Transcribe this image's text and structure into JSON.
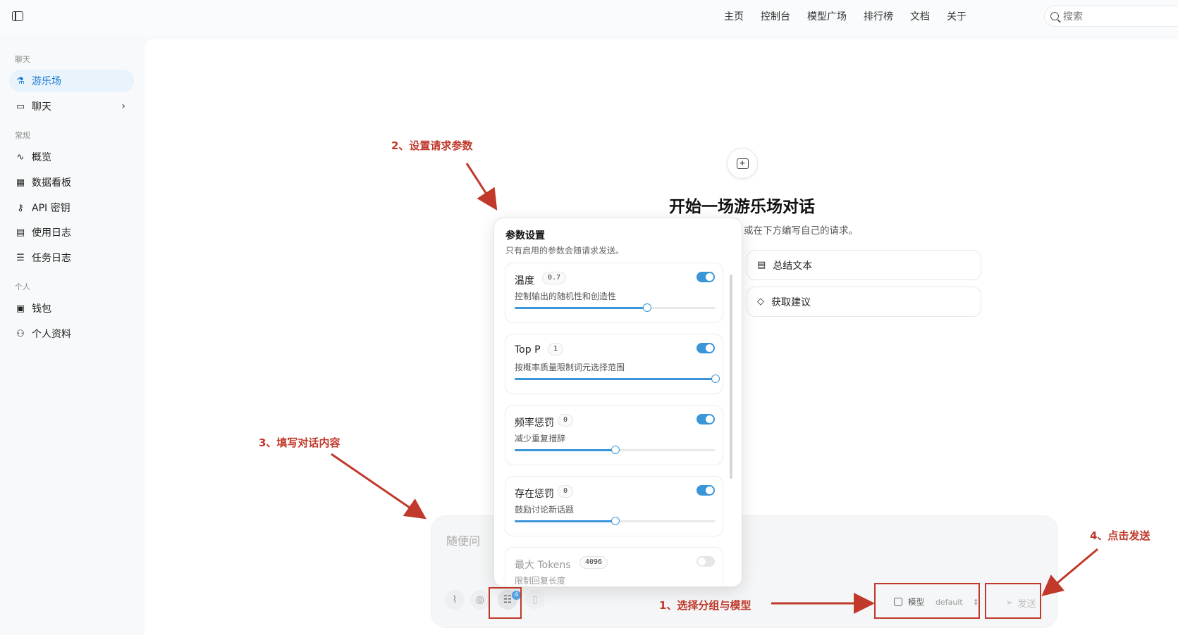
{
  "topnav": {
    "items": [
      "主页",
      "控制台",
      "模型广场",
      "排行榜",
      "文档",
      "关于"
    ],
    "search_placeholder": "搜索"
  },
  "sidebar": {
    "sections": {
      "chat": "聊天",
      "general": "常规",
      "personal": "个人"
    },
    "items": [
      {
        "label": "游乐场",
        "icon": "flask-icon",
        "active": true
      },
      {
        "label": "聊天",
        "icon": "chat-bubble-icon"
      },
      {
        "label": "概览",
        "icon": "activity-icon"
      },
      {
        "label": "数据看板",
        "icon": "dashboard-grid-icon"
      },
      {
        "label": "API 密钥",
        "icon": "key-icon"
      },
      {
        "label": "使用日志",
        "icon": "document-icon"
      },
      {
        "label": "任务日志",
        "icon": "task-list-icon"
      },
      {
        "label": "钱包",
        "icon": "wallet-icon"
      },
      {
        "label": "个人资料",
        "icon": "user-icon"
      }
    ]
  },
  "main": {
    "title": "开始一场游乐场对话",
    "subtitle": "或在下方编写自己的请求。",
    "suggestions": [
      "总结文本",
      "获取建议"
    ]
  },
  "params": {
    "title": "参数设置",
    "subtitle": "只有启用的参数会随请求发送。",
    "items": [
      {
        "name": "温度",
        "value": "0.7",
        "desc": "控制输出的随机性和创造性",
        "enabled": true,
        "level": 0.66
      },
      {
        "name": "Top P",
        "value": "1",
        "desc": "按概率质量限制词元选择范围",
        "enabled": true,
        "level": 1.0
      },
      {
        "name": "频率惩罚",
        "value": "0",
        "desc": "减少重复措辞",
        "enabled": true,
        "level": 0.5
      },
      {
        "name": "存在惩罚",
        "value": "0",
        "desc": "鼓励讨论新话题",
        "enabled": true,
        "level": 0.5
      },
      {
        "name": "最大 Tokens",
        "value": "4096",
        "desc": "限制回复长度",
        "enabled": false,
        "level": 0
      }
    ]
  },
  "composer": {
    "placeholder": "随便问",
    "param_badge": "4",
    "model_label": "模型",
    "model_value": "default",
    "send_label": "发送"
  },
  "annotations": {
    "step1": "1、选择分组与模型",
    "step2": "2、设置请求参数",
    "step3": "3、填写对话内容",
    "step4": "4、点击发送"
  },
  "colors": {
    "accent": "#3b95d9",
    "annotation": "#c0392b",
    "active_bg": "#e8f3fc"
  }
}
